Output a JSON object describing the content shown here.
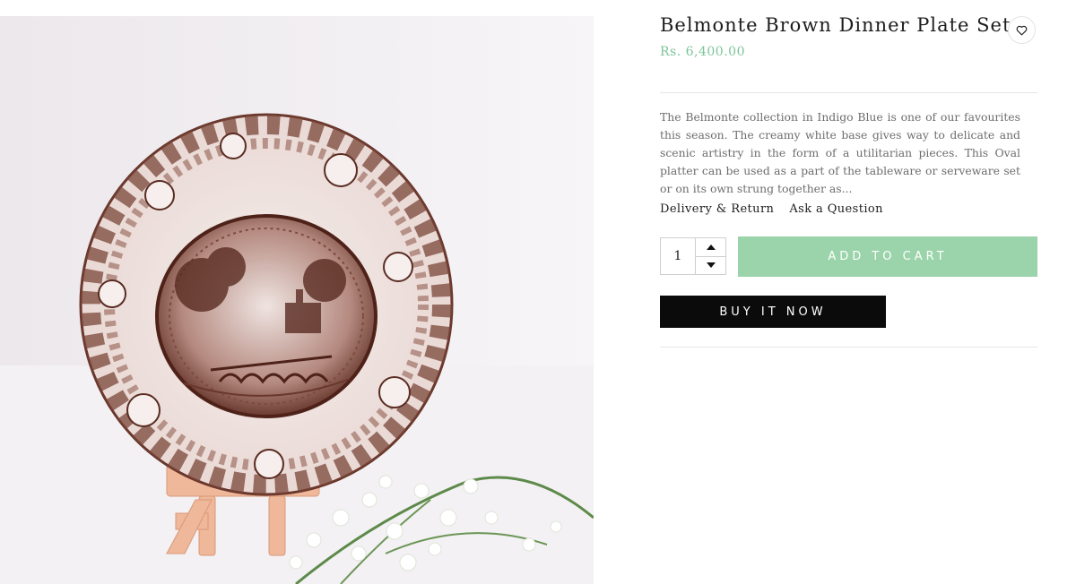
{
  "product": {
    "title": "Belmonte Brown Dinner Plate Set",
    "price": "Rs. 6,400.00",
    "description": "The Belmonte collection in Indigo Blue is one of our favourites this season. The creamy white base gives way to delicate and scenic artistry in the form of a utilitarian pieces. This Oval platter can be used as a part of the tableware or serveware set or on its own strung together as..."
  },
  "links": {
    "delivery_return": "Delivery & Return",
    "ask_question": "Ask a Question"
  },
  "quantity": {
    "value": "1"
  },
  "buttons": {
    "add_to_cart": "ADD TO CART",
    "buy_now": "BUY IT NOW"
  },
  "icons": {
    "wishlist": "heart-icon",
    "qty_up": "caret-up-icon",
    "qty_down": "caret-down-icon"
  },
  "colors": {
    "price": "#7cc49a",
    "add_to_cart_bg": "#9bd4ab",
    "buy_now_bg": "#0b0b0b",
    "plate_pattern": "#5a2c22"
  }
}
